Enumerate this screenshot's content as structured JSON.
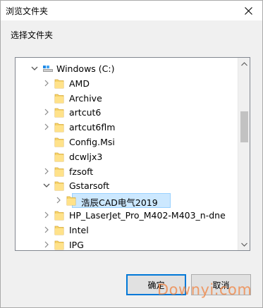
{
  "window": {
    "title": "浏览文件夹"
  },
  "instruction": "选择文件夹",
  "tree": {
    "items": [
      {
        "label": "Windows (C:)",
        "level": 0,
        "expanded": true,
        "has_children": true,
        "icon": "drive-icon"
      },
      {
        "label": "AMD",
        "level": 1,
        "expanded": false,
        "has_children": true,
        "icon": "folder-icon"
      },
      {
        "label": "Archive",
        "level": 1,
        "expanded": false,
        "has_children": false,
        "icon": "folder-icon"
      },
      {
        "label": "artcut6",
        "level": 1,
        "expanded": false,
        "has_children": true,
        "icon": "folder-icon"
      },
      {
        "label": "artcut6flm",
        "level": 1,
        "expanded": false,
        "has_children": true,
        "icon": "folder-icon"
      },
      {
        "label": "Config.Msi",
        "level": 1,
        "expanded": false,
        "has_children": false,
        "icon": "folder-icon"
      },
      {
        "label": "dcwljx3",
        "level": 1,
        "expanded": false,
        "has_children": false,
        "icon": "folder-icon"
      },
      {
        "label": "fzsoft",
        "level": 1,
        "expanded": false,
        "has_children": true,
        "icon": "folder-icon"
      },
      {
        "label": "Gstarsoft",
        "level": 1,
        "expanded": true,
        "has_children": true,
        "icon": "folder-icon"
      },
      {
        "label": "浩辰CAD电气2019",
        "level": 2,
        "expanded": false,
        "has_children": true,
        "icon": "folder-icon",
        "selected": true
      },
      {
        "label": "HP_LaserJet_Pro_M402-M403_n-dne",
        "level": 1,
        "expanded": false,
        "has_children": true,
        "icon": "folder-icon"
      },
      {
        "label": "Intel",
        "level": 1,
        "expanded": false,
        "has_children": true,
        "icon": "folder-icon"
      },
      {
        "label": "IPG",
        "level": 1,
        "expanded": false,
        "has_children": true,
        "icon": "folder-icon"
      }
    ]
  },
  "buttons": {
    "ok": "确定",
    "cancel": "取消"
  },
  "watermark": "Downyi.com",
  "colors": {
    "selection_bg": "#cce8ff",
    "selection_border": "#99d1ff",
    "default_button_border": "#0078d7",
    "folder": "#ffd866"
  }
}
